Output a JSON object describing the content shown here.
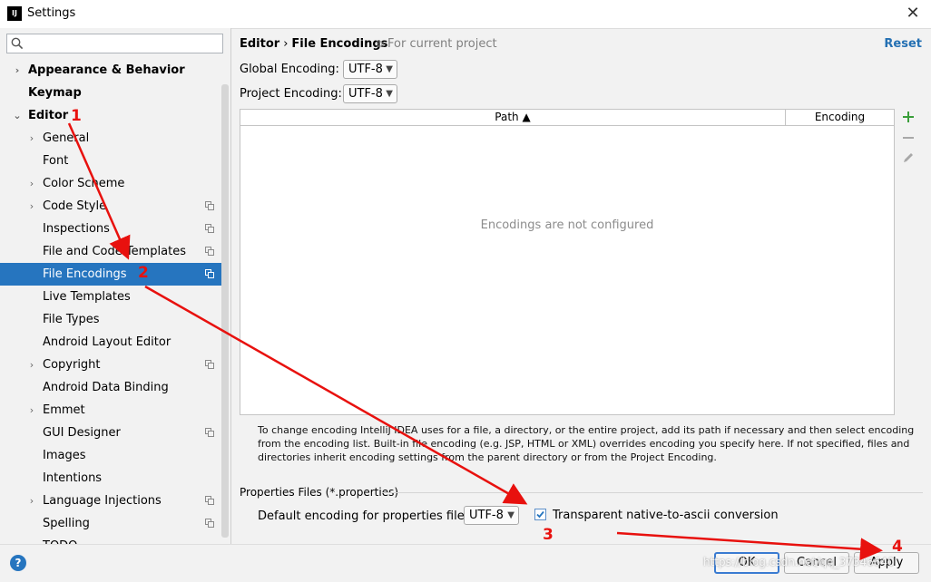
{
  "window": {
    "title": "Settings",
    "app_icon": "IJ",
    "close_glyph": "✕"
  },
  "search": {
    "placeholder": "",
    "value": ""
  },
  "sidebar": {
    "items": [
      {
        "label": "Appearance & Behavior",
        "level": 0,
        "bold": true,
        "expandable": true,
        "expanded": false,
        "copy": false,
        "selected": false
      },
      {
        "label": "Keymap",
        "level": 0,
        "bold": true,
        "expandable": false,
        "copy": false,
        "selected": false
      },
      {
        "label": "Editor",
        "level": 0,
        "bold": true,
        "expandable": true,
        "expanded": true,
        "copy": false,
        "selected": false
      },
      {
        "label": "General",
        "level": 1,
        "bold": false,
        "expandable": true,
        "expanded": false,
        "copy": false,
        "selected": false
      },
      {
        "label": "Font",
        "level": 1,
        "bold": false,
        "expandable": false,
        "copy": false,
        "selected": false
      },
      {
        "label": "Color Scheme",
        "level": 1,
        "bold": false,
        "expandable": true,
        "expanded": false,
        "copy": false,
        "selected": false
      },
      {
        "label": "Code Style",
        "level": 1,
        "bold": false,
        "expandable": true,
        "expanded": false,
        "copy": true,
        "selected": false
      },
      {
        "label": "Inspections",
        "level": 1,
        "bold": false,
        "expandable": false,
        "copy": true,
        "selected": false
      },
      {
        "label": "File and Code Templates",
        "level": 1,
        "bold": false,
        "expandable": false,
        "copy": true,
        "selected": false
      },
      {
        "label": "File Encodings",
        "level": 1,
        "bold": false,
        "expandable": false,
        "copy": true,
        "selected": true
      },
      {
        "label": "Live Templates",
        "level": 1,
        "bold": false,
        "expandable": false,
        "copy": false,
        "selected": false
      },
      {
        "label": "File Types",
        "level": 1,
        "bold": false,
        "expandable": false,
        "copy": false,
        "selected": false
      },
      {
        "label": "Android Layout Editor",
        "level": 1,
        "bold": false,
        "expandable": false,
        "copy": false,
        "selected": false
      },
      {
        "label": "Copyright",
        "level": 1,
        "bold": false,
        "expandable": true,
        "expanded": false,
        "copy": true,
        "selected": false
      },
      {
        "label": "Android Data Binding",
        "level": 1,
        "bold": false,
        "expandable": false,
        "copy": false,
        "selected": false
      },
      {
        "label": "Emmet",
        "level": 1,
        "bold": false,
        "expandable": true,
        "expanded": false,
        "copy": false,
        "selected": false
      },
      {
        "label": "GUI Designer",
        "level": 1,
        "bold": false,
        "expandable": false,
        "copy": true,
        "selected": false
      },
      {
        "label": "Images",
        "level": 1,
        "bold": false,
        "expandable": false,
        "copy": false,
        "selected": false
      },
      {
        "label": "Intentions",
        "level": 1,
        "bold": false,
        "expandable": false,
        "copy": false,
        "selected": false
      },
      {
        "label": "Language Injections",
        "level": 1,
        "bold": false,
        "expandable": true,
        "expanded": false,
        "copy": true,
        "selected": false
      },
      {
        "label": "Spelling",
        "level": 1,
        "bold": false,
        "expandable": false,
        "copy": true,
        "selected": false
      },
      {
        "label": "TODO",
        "level": 1,
        "bold": false,
        "expandable": false,
        "copy": false,
        "selected": false
      }
    ]
  },
  "header": {
    "crumb_parent": "Editor",
    "crumb_sep": "›",
    "crumb_current": "File Encodings",
    "scope_note": "For current project",
    "reset_label": "Reset"
  },
  "encodings": {
    "global_label": "Global Encoding:",
    "global_value": "UTF-8",
    "project_label": "Project Encoding:",
    "project_value": "UTF-8"
  },
  "table": {
    "columns": [
      "Path ▲",
      "Encoding"
    ],
    "empty_text": "Encodings are not configured",
    "rows": []
  },
  "help_text": "To change encoding IntelliJ IDEA uses for a file, a directory, or the entire project, add its path if necessary and then select encoding from the encoding list. Built-in file encoding (e.g. JSP, HTML or XML) overrides encoding you specify here. If not specified, files and directories inherit encoding settings from the parent directory or from the Project Encoding.",
  "properties": {
    "section_title": "Properties Files (*.properties)",
    "default_label": "Default encoding for properties files:",
    "default_value": "UTF-8",
    "transparent_label": "Transparent native-to-ascii conversion",
    "transparent_checked": true
  },
  "footer": {
    "help_glyph": "?",
    "ok_label": "OK",
    "cancel_label": "Cancel",
    "apply_label": "Apply",
    "watermark": "https://blog.csdn.net/qq_37346640"
  },
  "annotations": [
    "1",
    "2",
    "3",
    "4"
  ],
  "colors": {
    "selection": "#2675bf",
    "link": "#2470b3",
    "add_green": "#3a9e3a",
    "annotation_red": "#e8110e"
  }
}
